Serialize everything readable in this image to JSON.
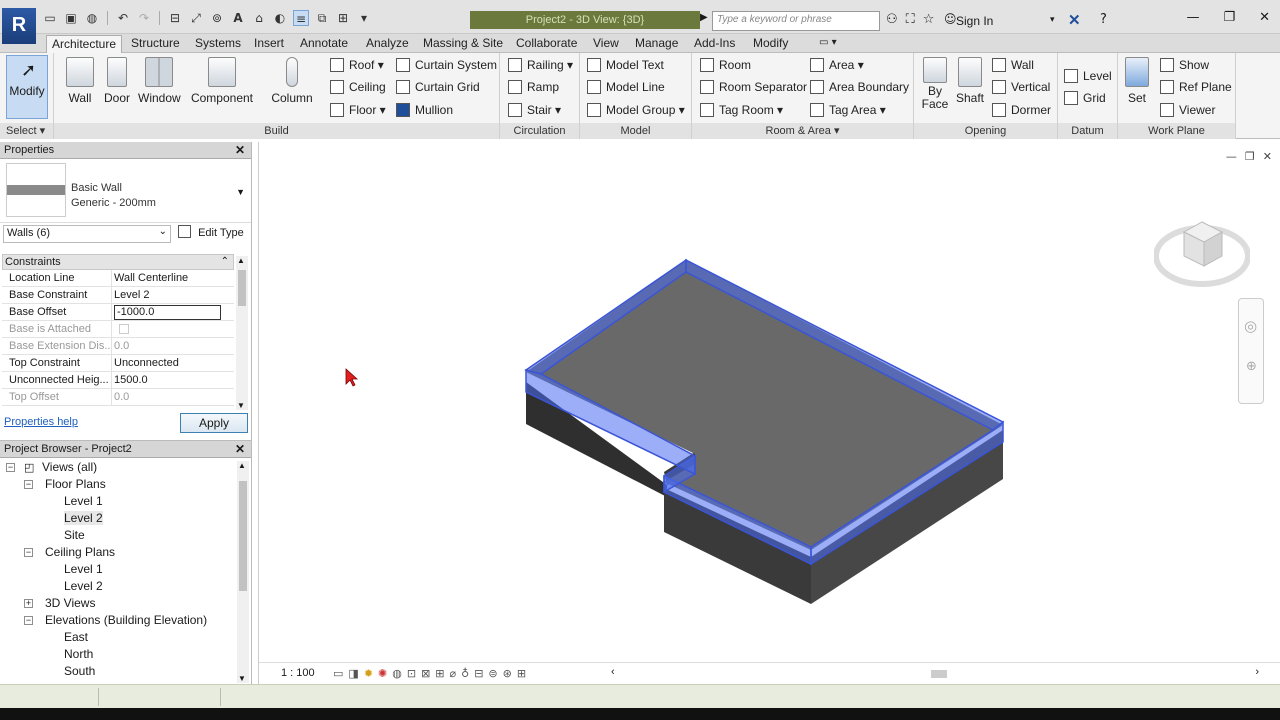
{
  "app": {
    "logo": "R",
    "window_title": "Project2 - 3D View: {3D}"
  },
  "quick_access": {
    "icons": [
      "open-icon",
      "save-icon",
      "sync-icon",
      "undo-icon",
      "redo-icon",
      "measure-icon",
      "dimension-icon",
      "tag-icon",
      "text-icon",
      "default-3d-icon",
      "section-icon",
      "thin-lines-icon",
      "close-windows-icon",
      "switch-windows-icon"
    ]
  },
  "search": {
    "placeholder": "Type a keyword or phrase"
  },
  "account": {
    "sign_in": "Sign In"
  },
  "tabs": [
    "Architecture",
    "Structure",
    "Systems",
    "Insert",
    "Annotate",
    "Analyze",
    "Massing & Site",
    "Collaborate",
    "View",
    "Manage",
    "Add-Ins",
    "Modify"
  ],
  "ribbon": {
    "select": {
      "modify_label": "Modify",
      "select_label": "Select ▾"
    },
    "build": {
      "title": "Build",
      "wall": "Wall",
      "door": "Door",
      "window": "Window",
      "component": "Component",
      "column": "Column",
      "roof": "Roof",
      "ceiling": "Ceiling",
      "floor": "Floor",
      "curtain_system": "Curtain System",
      "curtain_grid": "Curtain Grid",
      "mullion": "Mullion"
    },
    "circulation": {
      "title": "Circulation",
      "railing": "Railing",
      "ramp": "Ramp",
      "stair": "Stair"
    },
    "model": {
      "title": "Model",
      "model_text": "Model Text",
      "model_line": "Model Line",
      "model_group": "Model Group"
    },
    "room_area": {
      "title": "Room & Area ▾",
      "room": "Room",
      "room_separator": "Room Separator",
      "tag_room": "Tag Room",
      "area": "Area",
      "area_boundary": "Area Boundary",
      "tag_area": "Tag Area"
    },
    "opening": {
      "title": "Opening",
      "by_face_1": "By",
      "by_face_2": "Face",
      "shaft": "Shaft",
      "wall": "Wall",
      "vertical": "Vertical",
      "dormer": "Dormer"
    },
    "datum": {
      "title": "Datum",
      "level": "Level",
      "grid": "Grid"
    },
    "work_plane": {
      "title": "Work Plane",
      "set": "Set",
      "show": "Show",
      "ref_plane": "Ref Plane",
      "viewer": "Viewer"
    }
  },
  "properties": {
    "title": "Properties",
    "type_name_1": "Basic Wall",
    "type_name_2": "Generic - 200mm",
    "filter": "Walls (6)",
    "edit_type": "Edit Type",
    "section": "Constraints",
    "rows": [
      {
        "key": "Location Line",
        "value": "Wall Centerline"
      },
      {
        "key": "Base Constraint",
        "value": "Level 2"
      },
      {
        "key": "Base Offset",
        "value": "-1000.0"
      },
      {
        "key": "Base is Attached",
        "value": ""
      },
      {
        "key": "Base Extension Dis...",
        "value": "0.0"
      },
      {
        "key": "Top Constraint",
        "value": "Unconnected"
      },
      {
        "key": "Unconnected Heig...",
        "value": "1500.0"
      },
      {
        "key": "Top Offset",
        "value": "0.0"
      }
    ],
    "help": "Properties help",
    "apply": "Apply"
  },
  "browser": {
    "title": "Project Browser - Project2",
    "items": [
      {
        "label": "Views (all)"
      },
      {
        "label": "Floor Plans"
      },
      {
        "label": "Level 1"
      },
      {
        "label": "Level 2"
      },
      {
        "label": "Site"
      },
      {
        "label": "Ceiling Plans"
      },
      {
        "label": "Level 1"
      },
      {
        "label": "Level 2"
      },
      {
        "label": "3D Views"
      },
      {
        "label": "Elevations (Building Elevation)"
      },
      {
        "label": "East"
      },
      {
        "label": "North"
      },
      {
        "label": "South"
      }
    ]
  },
  "viewport": {
    "scale": "1 : 100"
  },
  "colors": {
    "accent": "#2d5aa6",
    "selection": "#4a6cf0",
    "wall_dark": "#2f2f2f",
    "floor": "#6a6a6a"
  }
}
